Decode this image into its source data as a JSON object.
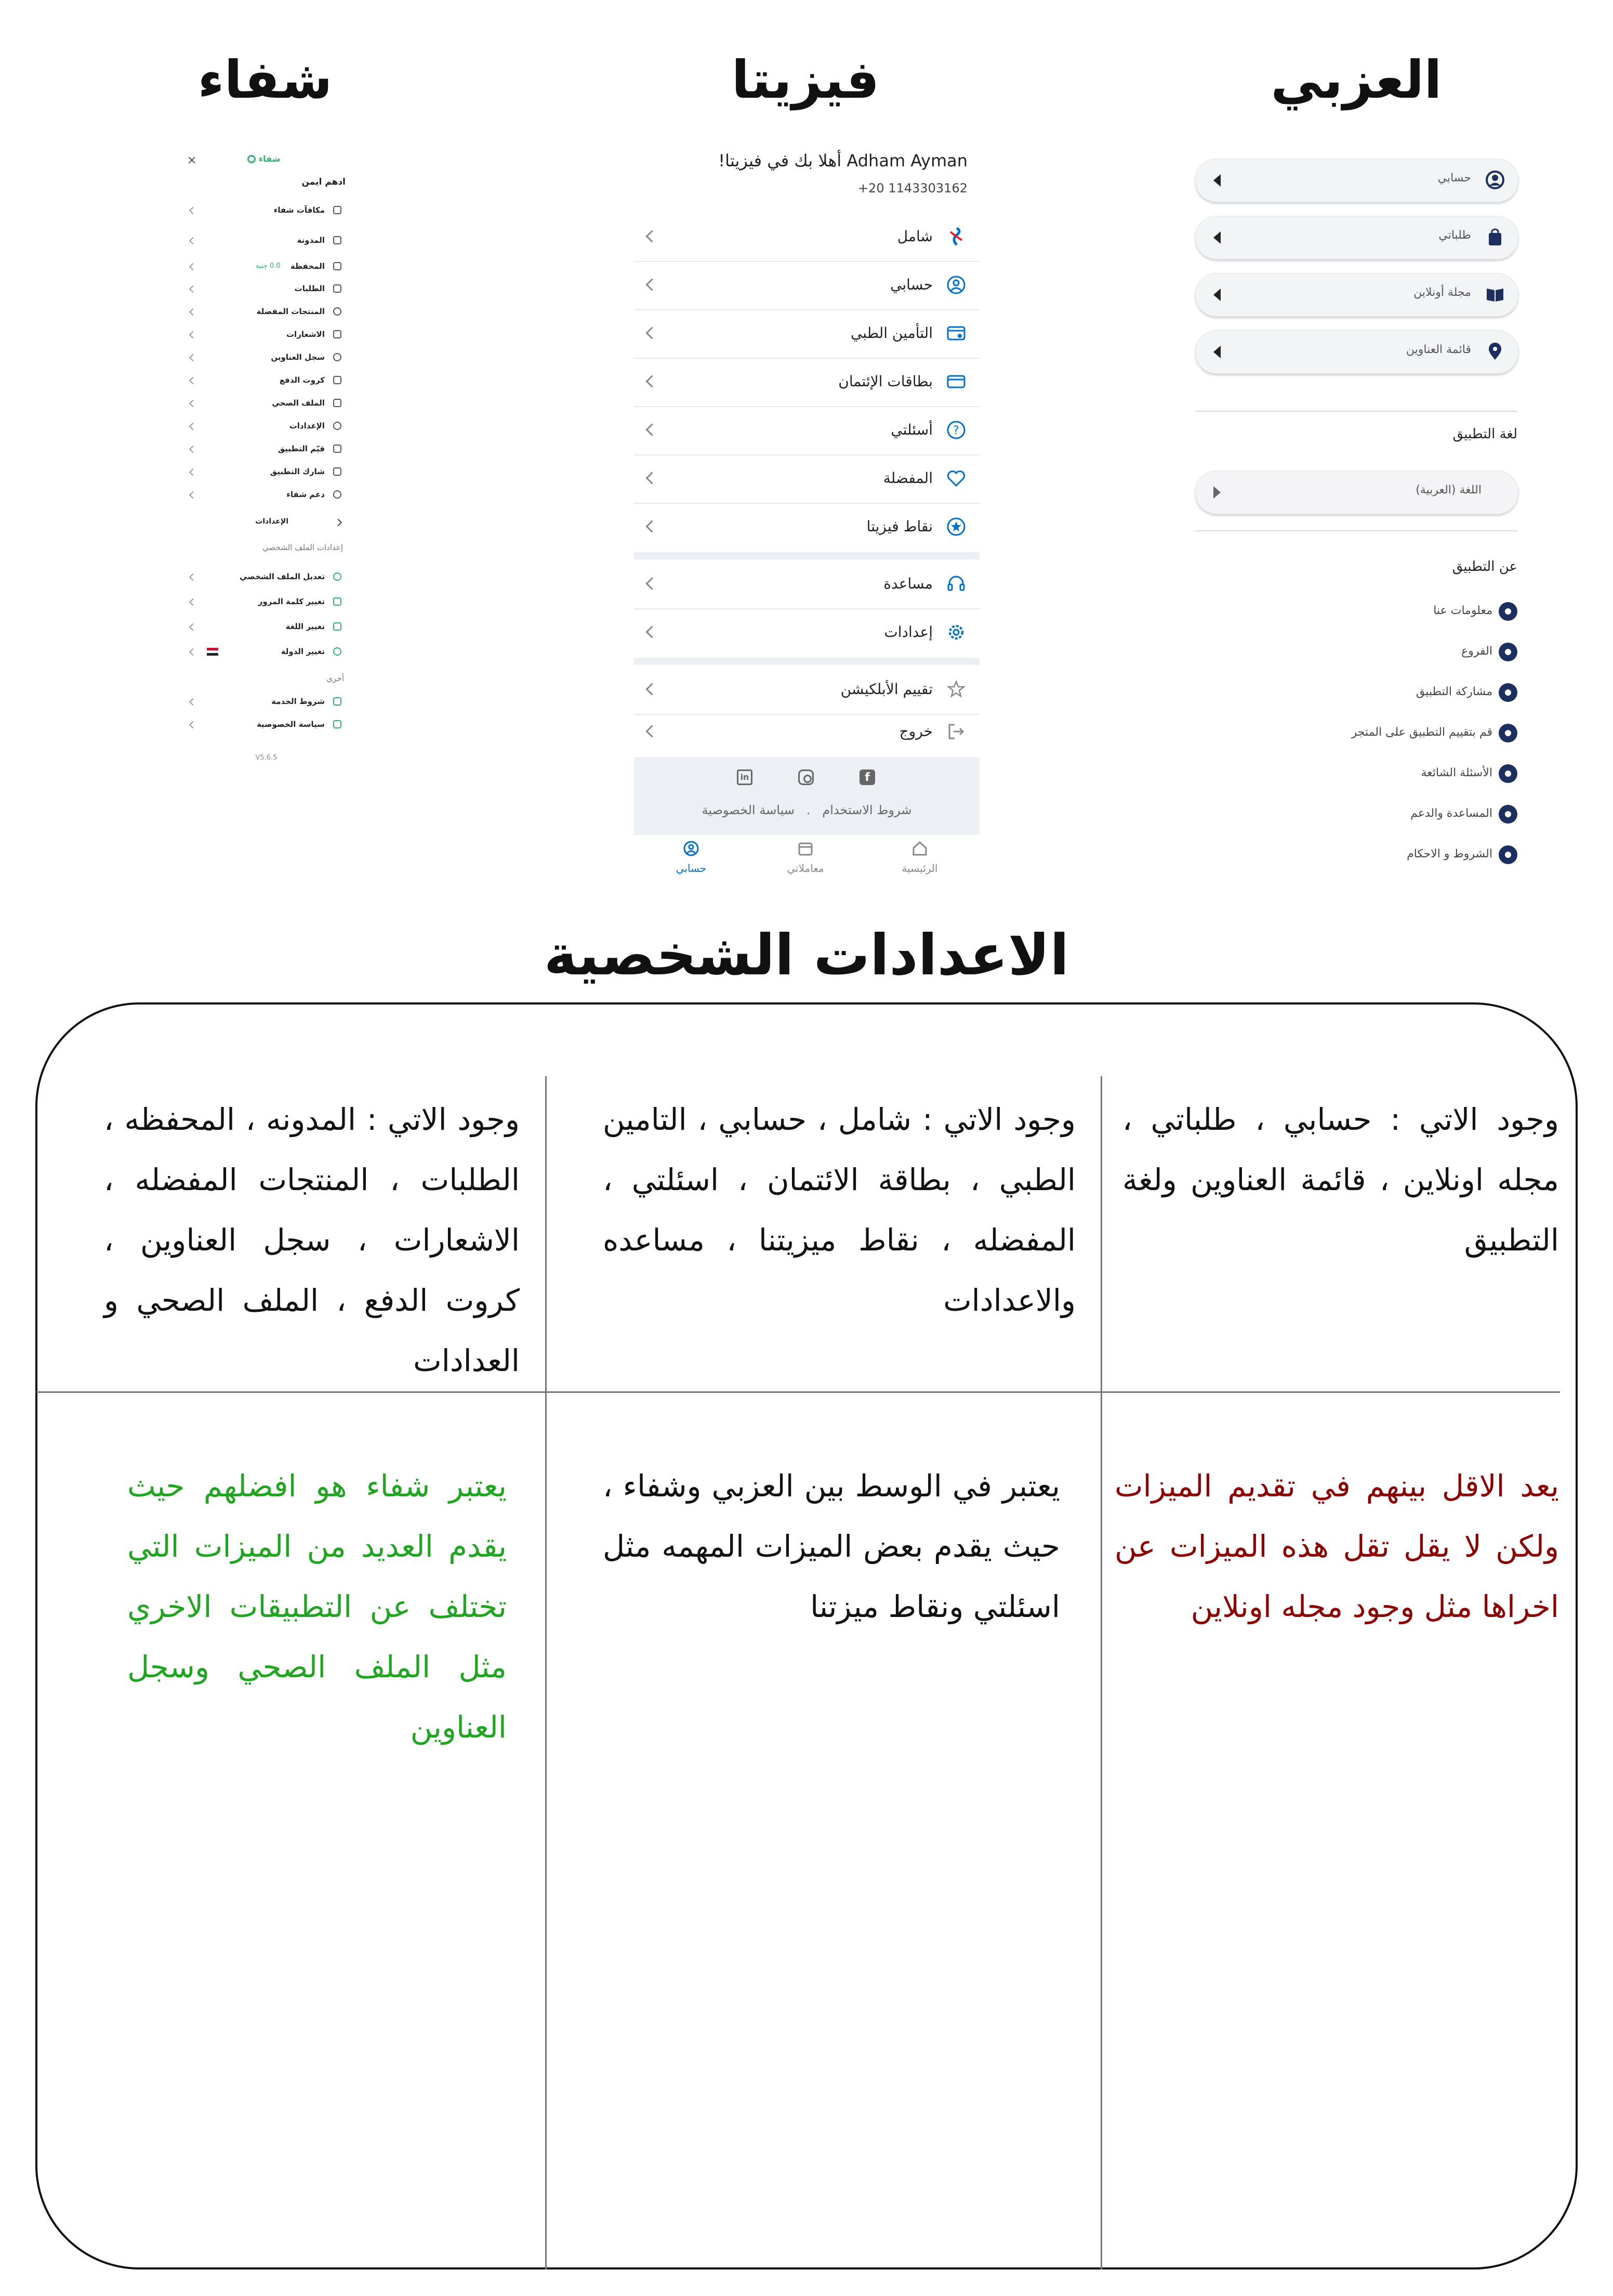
{
  "titles": {
    "ezaby": "العزبي",
    "vezeeta": "فيزيتا",
    "shefaa": "شفاء",
    "section": "الاعدادات الشخصية"
  },
  "ezaby": {
    "items": [
      {
        "label": "حسابي",
        "icon": "user-icon"
      },
      {
        "label": "طلباتي",
        "icon": "bag-icon"
      },
      {
        "label": "مجلة أونلاين",
        "icon": "book-icon"
      },
      {
        "label": "قائمة العناوين",
        "icon": "location-icon"
      }
    ],
    "language_heading": "لغة التطبيق",
    "language_value": "اللغة (العربية)",
    "about_heading": "عن التطبيق",
    "about_items": [
      {
        "label": "معلومات عنا",
        "icon": "info-icon"
      },
      {
        "label": "الفروع",
        "icon": "pin-icon"
      },
      {
        "label": "مشاركة التطبيق",
        "icon": "share-icon"
      },
      {
        "label": "قم بتقييم التطبيق على المتجر",
        "icon": "star-icon"
      },
      {
        "label": "الأسئلة الشائعة",
        "icon": "faq-icon"
      },
      {
        "label": "المساعدة والدعم",
        "icon": "help-icon"
      },
      {
        "label": "الشروط و الاحكام",
        "icon": "document-icon"
      }
    ],
    "brand_color": "#1c2f5e"
  },
  "vezeeta": {
    "greeting": "!أهلا بك في فيزيتا Adham Ayman",
    "phone": "+20 1143303162",
    "group1": [
      {
        "label": "شامل",
        "icon": "shamel-logo-icon"
      },
      {
        "label": "حسابي",
        "icon": "user-circle-icon"
      },
      {
        "label": "التأمين الطبي",
        "icon": "insurance-card-icon"
      },
      {
        "label": "بطاقات الإئتمان",
        "icon": "credit-card-icon"
      },
      {
        "label": "أسئلتي",
        "icon": "question-icon"
      },
      {
        "label": "المفضلة",
        "icon": "heart-icon"
      },
      {
        "label": "نقاط فيزيتا",
        "icon": "points-star-icon"
      }
    ],
    "group2": [
      {
        "label": "مساعدة",
        "icon": "headset-icon"
      },
      {
        "label": "إعدادات",
        "icon": "settings-icon"
      }
    ],
    "group3": [
      {
        "label": "تقييم الأبلكيشن",
        "icon": "star-outline-icon"
      },
      {
        "label": "خروج",
        "icon": "logout-icon"
      }
    ],
    "footer_links": "شروط الاستخدام   .   سياسة الخصوصية",
    "bottom_nav": [
      {
        "label": "الرئيسية",
        "icon": "home-icon"
      },
      {
        "label": "معاملاتي",
        "icon": "calendar-icon"
      },
      {
        "label": "حسابي",
        "icon": "account-icon",
        "active": true
      }
    ],
    "accent_color": "#0070cd"
  },
  "shefaa": {
    "brand": "شفاء",
    "user_name": "ادهم ايمن",
    "items": [
      {
        "label": "مكافآت شفاء"
      },
      {
        "label": "المدونة"
      },
      {
        "label": "المحفظة",
        "badge": "0.0 جنيه"
      },
      {
        "label": "الطلبات"
      },
      {
        "label": "المنتجات المفضلة"
      },
      {
        "label": "الاشعارات"
      },
      {
        "label": "سجل العناوين"
      },
      {
        "label": "كروت الدفع"
      },
      {
        "label": "الملف الصحي"
      },
      {
        "label": "الإعدادات"
      },
      {
        "label": "قيّم التطبيق"
      },
      {
        "label": "شارك التطبيق"
      },
      {
        "label": "دعم شفاء"
      }
    ],
    "settings_back": "الإعدادات",
    "profile_heading": "إعدادات الملف الشخصي",
    "profile_items": [
      {
        "label": "تعديل الملف الشخصي"
      },
      {
        "label": "تغيير كلمة المرور"
      },
      {
        "label": "تغيير اللغة"
      },
      {
        "label": "تغيير الدولة"
      }
    ],
    "other_heading": "أخرى",
    "other_items": [
      {
        "label": "شروط الخدمة"
      },
      {
        "label": "سياسة الخصوصية"
      }
    ],
    "version": "V5.6.5",
    "brand_color": "#2db36b"
  },
  "table": {
    "features": {
      "ezaby": "وجود الاتي : حسابي ، طلباتي ، مجله اونلاين ، قائمة العناوين ولغة التطبيق",
      "vezeeta": "وجود الاتي : شامل ، حسابي ، التامين الطبي ، بطاقة الائتمان ، اسئلتي ، المفضله ، نقاط ميزيتنا ، مساعده والاعدادات",
      "shefaa": "وجود الاتي : المدونه ، المحفظه ، الطلبات ، المنتجات المفضله ، الاشعارات ، سجل العناوين ، كروت الدفع ، الملف الصحي و العدادات"
    },
    "verdicts": {
      "ezaby": "يعد الاقل بينهم في تقديم الميزات ولكن لا يقل تقل هذه الميزات عن اخراها مثل وجود مجله اونلاين",
      "vezeeta": "يعتبر في الوسط بين العزبي وشفاء ، حيث يقدم بعض الميزات المهمه مثل اسئلتي ونقاط ميزتنا",
      "shefaa": "يعتبر شفاء هو افضلهم حيث يقدم العديد من الميزات التي تختلف عن التطبيقات الاخري مثل الملف الصحي وسجل العناوين"
    },
    "colors": {
      "ezaby_verdict": "#8b0000",
      "vezeeta_verdict": "#111111",
      "shefaa_verdict": "#1fa51f"
    }
  }
}
